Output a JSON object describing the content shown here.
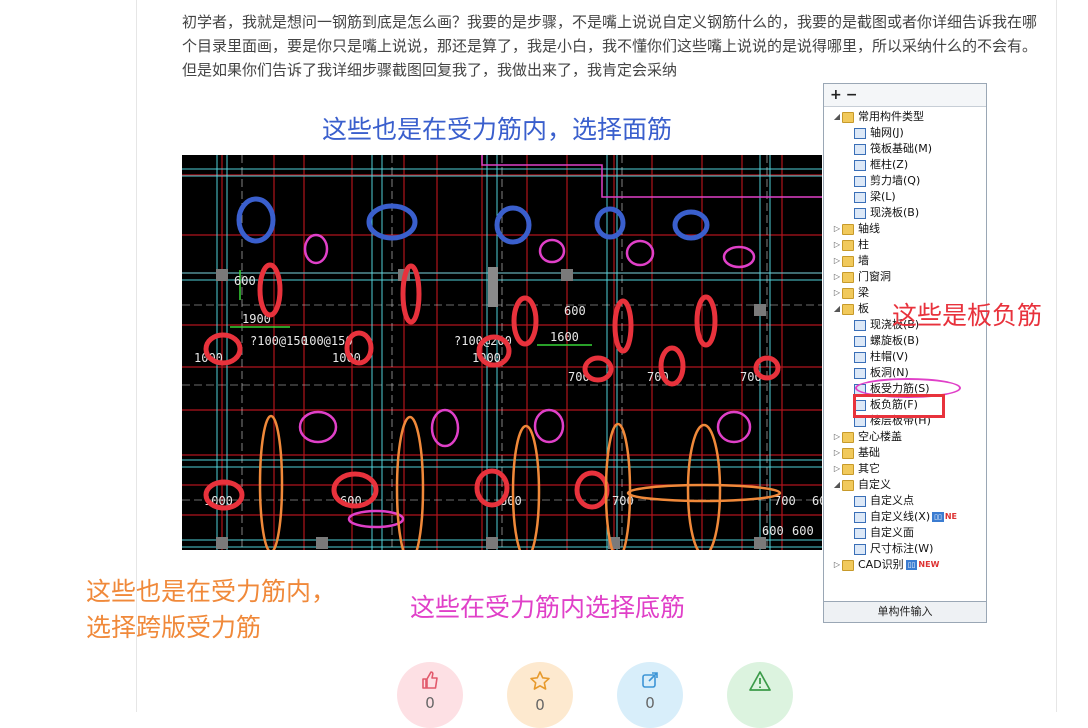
{
  "question": "初学者，我就是想问一钢筋到底是怎么画？我要的是步骤，不是嘴上说说自定义钢筋什么的，我要的是截图或者你详细告诉我在哪个目录里面画，要是你只是嘴上说说，那还是算了，我是小白，我不懂你们这些嘴上说说的是说得哪里，所以采纳什么的不会有。但是如果你们告诉了我详细步骤截图回复我了，我做出来了，我肯定会采纳",
  "annotations": {
    "blue": "这些也是在受力筋内，选择面筋",
    "red": "这些是板负筋",
    "orange_line1": "这些也是在受力筋内，",
    "orange_line2": "选择跨版受力筋",
    "magenta": "这些在受力筋内选择底筋"
  },
  "cad_labels": [
    "1900",
    "600",
    "1600",
    "600",
    "?100@150",
    "100@150",
    "?100@200",
    "1000",
    "1000",
    "1000",
    "700",
    "700",
    "700",
    "1000",
    "700",
    "700",
    "600",
    "600",
    "600",
    "600",
    "600"
  ],
  "tree": {
    "toolbar": [
      "+",
      "−"
    ],
    "items": [
      {
        "label": "常用构件类型",
        "level": 0,
        "kind": "folder",
        "open": true
      },
      {
        "label": "轴网(J)",
        "level": 1,
        "kind": "comp"
      },
      {
        "label": "筏板基础(M)",
        "level": 1,
        "kind": "comp"
      },
      {
        "label": "框柱(Z)",
        "level": 1,
        "kind": "comp"
      },
      {
        "label": "剪力墙(Q)",
        "level": 1,
        "kind": "comp"
      },
      {
        "label": "梁(L)",
        "level": 1,
        "kind": "comp"
      },
      {
        "label": "现浇板(B)",
        "level": 1,
        "kind": "comp"
      },
      {
        "label": "轴线",
        "level": 0,
        "kind": "folder"
      },
      {
        "label": "柱",
        "level": 0,
        "kind": "folder"
      },
      {
        "label": "墙",
        "level": 0,
        "kind": "folder"
      },
      {
        "label": "门窗洞",
        "level": 0,
        "kind": "folder"
      },
      {
        "label": "梁",
        "level": 0,
        "kind": "folder"
      },
      {
        "label": "板",
        "level": 0,
        "kind": "folder",
        "open": true
      },
      {
        "label": "现浇板(B)",
        "level": 1,
        "kind": "comp"
      },
      {
        "label": "螺旋板(B)",
        "level": 1,
        "kind": "comp"
      },
      {
        "label": "柱帽(V)",
        "level": 1,
        "kind": "comp"
      },
      {
        "label": "板洞(N)",
        "level": 1,
        "kind": "comp"
      },
      {
        "label": "板受力筋(S)",
        "level": 1,
        "kind": "comp"
      },
      {
        "label": "板负筋(F)",
        "level": 1,
        "kind": "comp"
      },
      {
        "label": "楼层板带(H)",
        "level": 1,
        "kind": "comp"
      },
      {
        "label": "空心楼盖",
        "level": 0,
        "kind": "folder"
      },
      {
        "label": "基础",
        "level": 0,
        "kind": "folder"
      },
      {
        "label": "其它",
        "level": 0,
        "kind": "folder"
      },
      {
        "label": "自定义",
        "level": 0,
        "kind": "folder",
        "open": true
      },
      {
        "label": "自定义点",
        "level": 1,
        "kind": "comp"
      },
      {
        "label": "自定义线(X)",
        "level": 1,
        "kind": "comp",
        "badge": "NE"
      },
      {
        "label": "自定义面",
        "level": 1,
        "kind": "comp"
      },
      {
        "label": "尺寸标注(W)",
        "level": 1,
        "kind": "comp"
      },
      {
        "label": "CAD识别",
        "level": 0,
        "kind": "folder",
        "badge": "NEW"
      }
    ],
    "footer": "单构件输入"
  },
  "actions": [
    {
      "name": "like",
      "count": "0",
      "icon": "thumbs-up-icon"
    },
    {
      "name": "favorite",
      "count": "0",
      "icon": "star-icon"
    },
    {
      "name": "share",
      "count": "0",
      "icon": "share-icon"
    },
    {
      "name": "report",
      "count": "",
      "icon": "warning-icon"
    }
  ],
  "colors": {
    "blue": "#3a5fcd",
    "red": "#e8323c",
    "orange": "#f0893a",
    "magenta": "#e040c8"
  }
}
